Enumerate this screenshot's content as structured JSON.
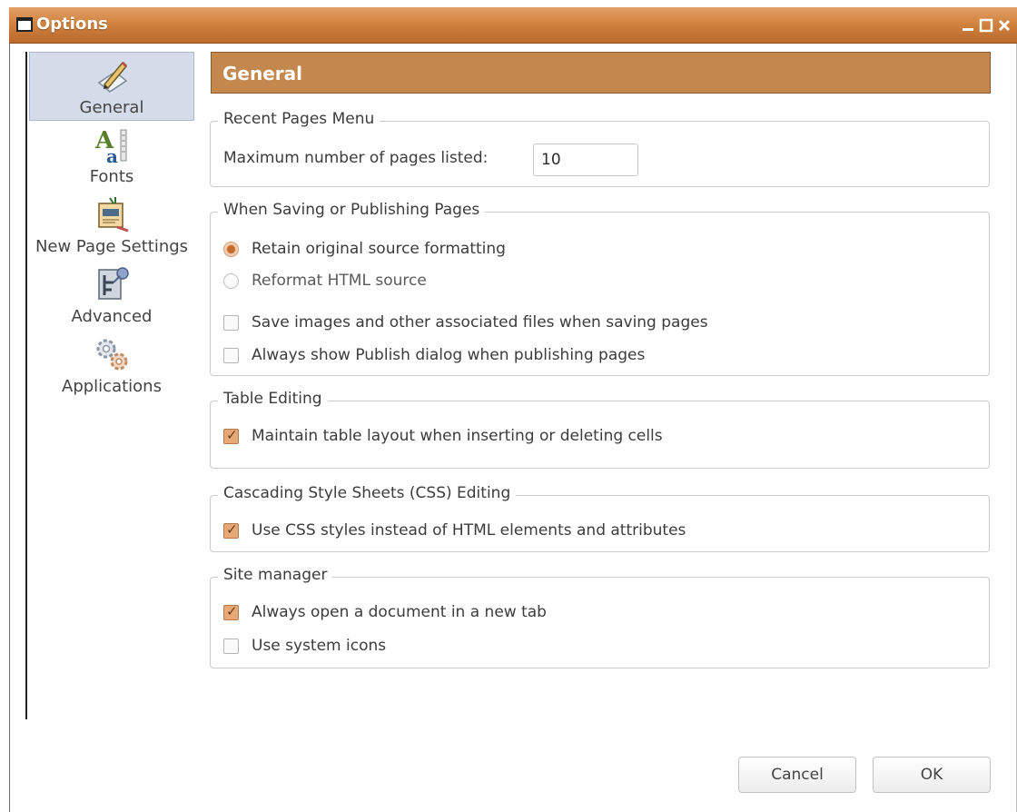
{
  "window": {
    "title": "Options",
    "controls": [
      "minimize-icon",
      "maximize-icon",
      "close-icon"
    ]
  },
  "sidebar": {
    "items": [
      {
        "label": "General",
        "icon": "pencil-paper-icon",
        "selected": true
      },
      {
        "label": "Fonts",
        "icon": "fonts-icon",
        "selected": false
      },
      {
        "label": "New Page Settings",
        "icon": "new-page-settings-icon",
        "selected": false
      },
      {
        "label": "Advanced",
        "icon": "advanced-icon",
        "selected": false
      },
      {
        "label": "Applications",
        "icon": "gears-icon",
        "selected": false
      }
    ]
  },
  "section_title": "General",
  "recent_pages": {
    "legend": "Recent Pages Menu",
    "label": "Maximum number of pages listed:",
    "value": "10"
  },
  "saving": {
    "legend": "When Saving or Publishing Pages",
    "radio_retain": {
      "label": "Retain original source formatting",
      "checked": true
    },
    "radio_reformat": {
      "label": "Reformat HTML source",
      "checked": false
    },
    "check_save_images": {
      "label": "Save images and other associated files when saving pages",
      "checked": false
    },
    "check_publish_dialog": {
      "label": "Always show Publish dialog when publishing pages",
      "checked": false
    }
  },
  "table_editing": {
    "legend": "Table Editing",
    "check_maintain": {
      "label": "Maintain table layout when inserting or deleting cells",
      "checked": true
    }
  },
  "css_editing": {
    "legend": "Cascading Style Sheets (CSS) Editing",
    "check_css": {
      "label": "Use CSS styles instead of HTML elements and attributes",
      "checked": true
    }
  },
  "site_manager": {
    "legend": "Site manager",
    "check_new_tab": {
      "label": "Always open a document in a new tab",
      "checked": true
    },
    "check_system_icons": {
      "label": "Use system icons",
      "checked": false
    }
  },
  "buttons": {
    "cancel": "Cancel",
    "ok": "OK"
  },
  "colors": {
    "titlebar": "#d2833f",
    "section_header": "#c4874d",
    "checkbox_checked": "#e7a877",
    "sidebar_selected": "#d3dce8"
  }
}
